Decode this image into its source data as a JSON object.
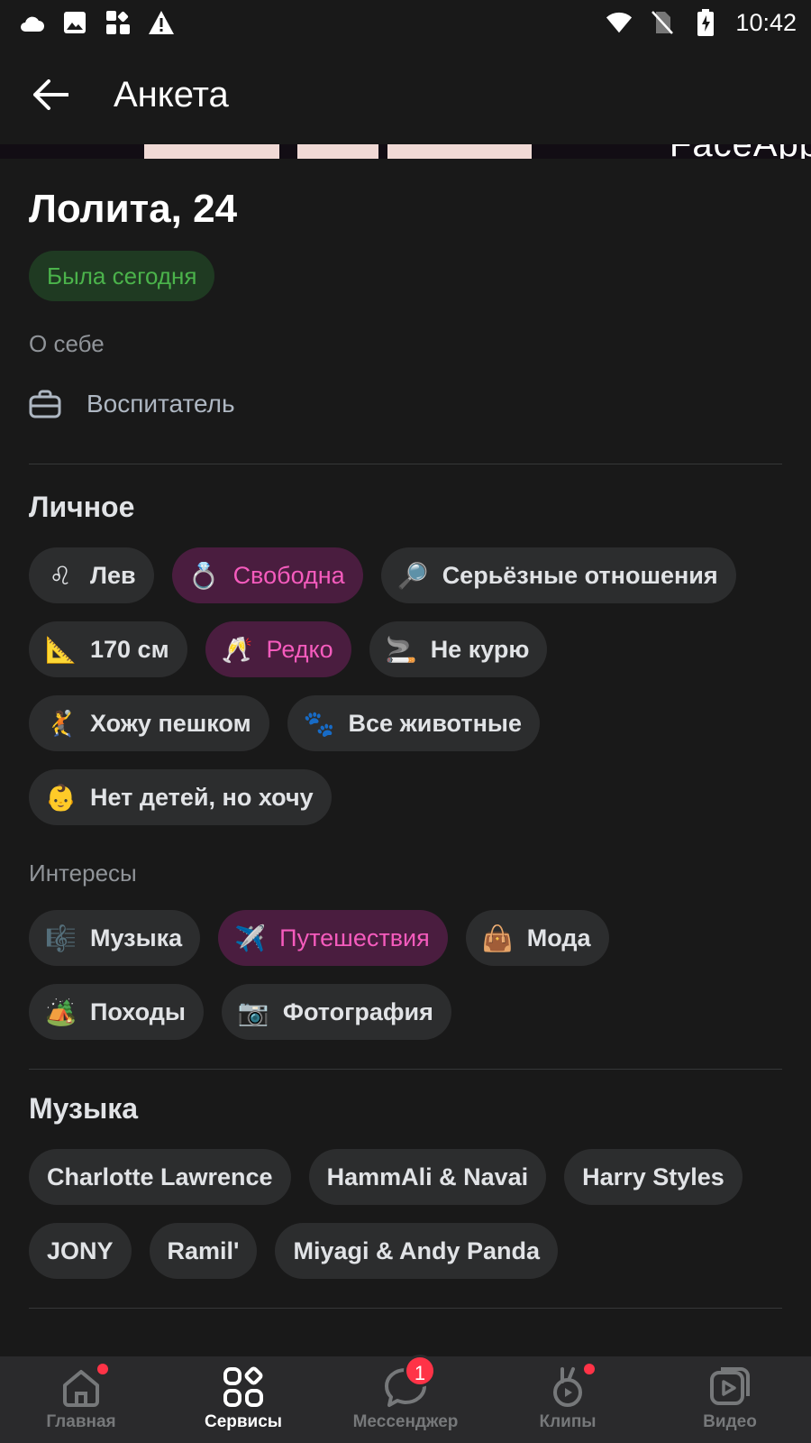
{
  "status_bar": {
    "time": "10:42",
    "left_icons": [
      "cloud-icon",
      "image-icon",
      "apps-icon",
      "warning-icon"
    ],
    "right_icons": [
      "wifi-icon",
      "no-sim-icon",
      "battery-charging-icon"
    ]
  },
  "app_bar": {
    "title": "Анкета"
  },
  "photo": {
    "watermark": "FaceApp"
  },
  "profile": {
    "name": "Лолита, 24",
    "online_status": "Была сегодня",
    "about_caption": "О себе",
    "occupation": "Воспитатель"
  },
  "personal": {
    "title": "Личное",
    "chips": [
      {
        "emoji": "♌",
        "label": "Лев",
        "accent": false
      },
      {
        "emoji": "💍",
        "label": "Свободна",
        "accent": true
      },
      {
        "emoji": "🔎",
        "label": "Серьёзные отношения",
        "accent": false
      },
      {
        "emoji": "📐",
        "label": "170 см",
        "accent": false
      },
      {
        "emoji": "🥂",
        "label": "Редко",
        "accent": true
      },
      {
        "emoji": "🚬",
        "label": "Не курю",
        "accent": false
      },
      {
        "emoji": "🤾",
        "label": "Хожу пешком",
        "accent": false
      },
      {
        "emoji": "🐾",
        "label": "Все животные",
        "accent": false
      },
      {
        "emoji": "👶",
        "label": "Нет детей, но хочу",
        "accent": false
      }
    ]
  },
  "interests": {
    "caption": "Интересы",
    "chips": [
      {
        "emoji": "🎼",
        "label": "Музыка",
        "accent": false
      },
      {
        "emoji": "✈️",
        "label": "Путешествия",
        "accent": true
      },
      {
        "emoji": "👜",
        "label": "Мода",
        "accent": false
      },
      {
        "emoji": "🏕️",
        "label": "Походы",
        "accent": false
      },
      {
        "emoji": "📷",
        "label": "Фотография",
        "accent": false
      }
    ]
  },
  "music": {
    "title": "Музыка",
    "artists": [
      "Charlotte Lawrence",
      "HammAli & Navai",
      "Harry Styles",
      "JONY",
      "Ramil'",
      "Miyagi & Andy Panda"
    ]
  },
  "bottom_nav": {
    "items": [
      {
        "label": "Главная",
        "icon": "home-icon",
        "active": false,
        "dot": true
      },
      {
        "label": "Сервисы",
        "icon": "services-icon",
        "active": true,
        "dot": false
      },
      {
        "label": "Мессенджер",
        "icon": "messenger-icon",
        "active": false,
        "badge": "1"
      },
      {
        "label": "Клипы",
        "icon": "clips-icon",
        "active": false,
        "dot": true
      },
      {
        "label": "Видео",
        "icon": "video-icon",
        "active": false,
        "dot": false
      }
    ]
  },
  "colors": {
    "background": "#191919",
    "chip": "#2c2d2e",
    "accent_chip_bg": "#4a1d3f",
    "accent_text": "#f55bbd",
    "online_green": "#4bb34b",
    "badge_red": "#ff3347"
  }
}
